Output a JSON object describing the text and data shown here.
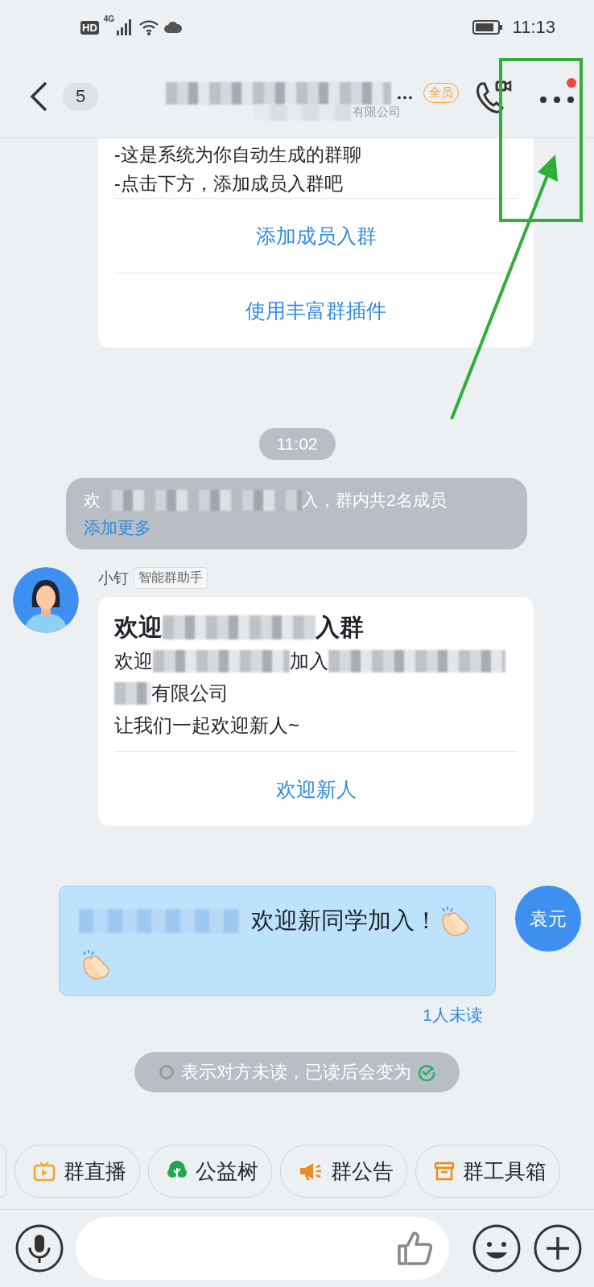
{
  "status_bar": {
    "hd": "HD",
    "network": "4G",
    "time": "11:13"
  },
  "header": {
    "unread_count": "5",
    "title": "…",
    "badge": "全员",
    "subtitle": "有限公司",
    "more_has_dot": true
  },
  "messages": [
    {
      "kind": "card",
      "lines": [
        "-这是系统为你自动生成的群聊",
        "-点击下方，添加成员入群吧"
      ],
      "actions": [
        "添加成员入群",
        "使用丰富群插件"
      ]
    },
    {
      "kind": "time",
      "text": "11:02"
    },
    {
      "kind": "system",
      "parts": [
        "欢",
        "入，群内共2名成员"
      ],
      "link": "添加更多"
    },
    {
      "kind": "bot",
      "sender": "小钉",
      "tag": "智能群助手",
      "title_parts": [
        "欢迎",
        "入群"
      ],
      "body_parts": [
        "欢迎",
        "加入"
      ],
      "lines": [
        "有限公司",
        "让我们一起欢迎新人~"
      ],
      "actions": [
        "欢迎新人"
      ]
    },
    {
      "kind": "outgoing",
      "text": "欢迎新同学加入！",
      "reactions": [
        {
          "kind": "clap"
        },
        {
          "kind": "clap"
        }
      ],
      "avatar": "袁元",
      "read_status": "1人未读"
    },
    {
      "kind": "hint",
      "text": "表示对方未读，已读后会变为"
    }
  ],
  "shortcuts": [
    {
      "kind": "live",
      "label": "群直播"
    },
    {
      "kind": "tree",
      "label": "公益树"
    },
    {
      "kind": "notice",
      "label": "群公告"
    },
    {
      "kind": "toolbox",
      "label": "群工具箱"
    }
  ]
}
